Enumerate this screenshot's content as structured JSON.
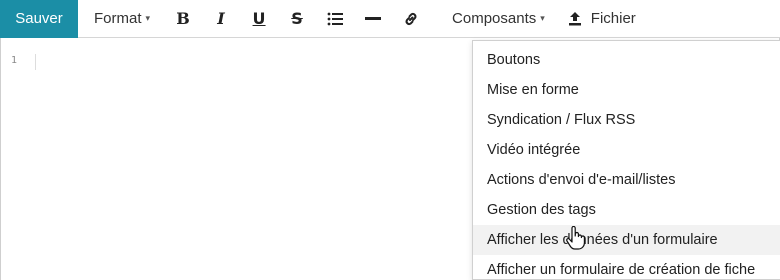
{
  "toolbar": {
    "save_label": "Sauver",
    "format_label": "Format",
    "components_label": "Composants",
    "file_label": "Fichier",
    "accent_color": "#1b8ea6",
    "icons": [
      "bold-icon",
      "italic-icon",
      "underline-icon",
      "strikethrough-icon",
      "list-icon",
      "horizontal-rule-icon",
      "link-icon",
      "upload-icon"
    ]
  },
  "editor": {
    "line_numbers": [
      "1"
    ]
  },
  "components_menu": {
    "items": [
      "Boutons",
      "Mise en forme",
      "Syndication / Flux RSS",
      "Vidéo intégrée",
      "Actions d'envoi d'e-mail/listes",
      "Gestion des tags",
      "Afficher les données d'un formulaire",
      "Afficher un formulaire de création de fiche"
    ],
    "hovered_item": "Afficher les données d'un formulaire"
  }
}
